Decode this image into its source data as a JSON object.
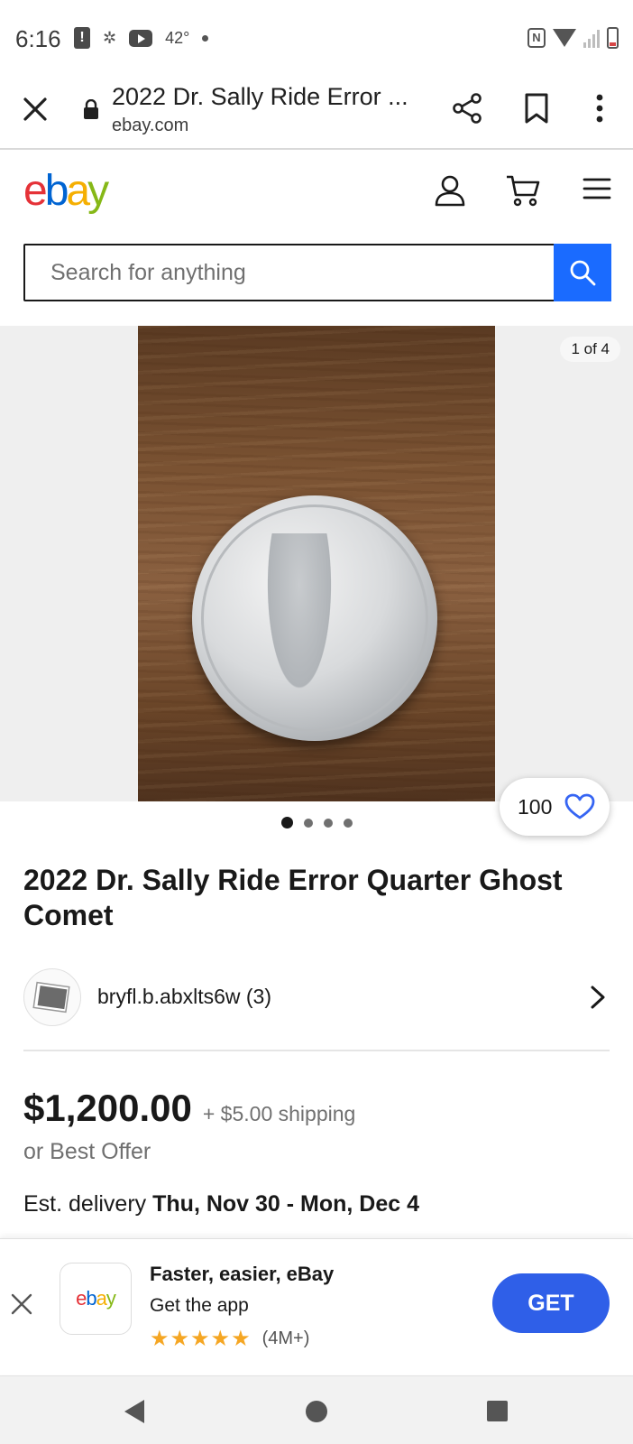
{
  "status_bar": {
    "time": "6:16",
    "temperature": "42°"
  },
  "browser": {
    "page_title": "2022 Dr. Sally Ride Error ...",
    "domain": "ebay.com"
  },
  "ebay": {
    "logo_letters": [
      "e",
      "b",
      "a",
      "y"
    ],
    "brand_colors": {
      "e": "#e53238",
      "b": "#0064d2",
      "a": "#f5af02",
      "y": "#86b817"
    },
    "search_placeholder": "Search for anything",
    "accent_color": "#1a6bff"
  },
  "gallery": {
    "counter": "1 of 4",
    "watch_count": "100",
    "dot_count": 4,
    "active_dot": 0
  },
  "listing": {
    "title": "2022 Dr. Sally Ride Error Quarter Ghost Comet",
    "seller": "bryfl.b.abxlts6w (3)",
    "price": "$1,200.00",
    "shipping": "+ $5.00 shipping",
    "best_offer": "or Best Offer",
    "delivery_label": "Est. delivery",
    "delivery_dates": "Thu, Nov 30 - Mon, Dec 4"
  },
  "app_banner": {
    "title": "Faster, easier, eBay",
    "subtitle": "Get the app",
    "stars": "★★★★★",
    "rating_count": "(4M+)",
    "get_label": "GET"
  }
}
